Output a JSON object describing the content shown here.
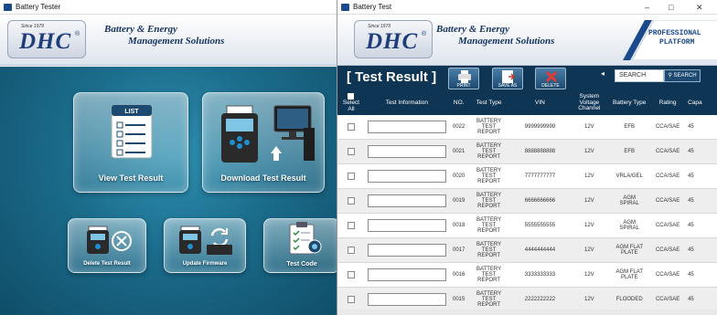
{
  "colors": {
    "header_bg": "#0f3554",
    "brand_blue": "#1f3d7a",
    "panel_teal": "#1b6b8b"
  },
  "left_window": {
    "title": "Battery Tester",
    "logo": {
      "since": "Since 1979",
      "brand": "DHC",
      "reg": "®"
    },
    "tagline_line1": "Battery & Energy",
    "tagline_line2": "Management Solutions",
    "tiles": {
      "view": {
        "label": "View Test Result",
        "icon": "list-icon",
        "list_caption": "LIST"
      },
      "download": {
        "label": "Download Test Result",
        "icon": "tester-to-pc-icon"
      },
      "delete": {
        "label": "Delete Test Result",
        "icon": "tester-delete-icon"
      },
      "update": {
        "label": "Update Firmware",
        "icon": "tester-sync-icon"
      },
      "testcode": {
        "label": "Test Code",
        "icon": "clipboard-badge-icon"
      }
    }
  },
  "right_window": {
    "title": "Battery Test",
    "controls": {
      "minimize": "–",
      "maximize": "□",
      "close": "✕"
    },
    "logo": {
      "since": "Since 1979",
      "brand": "DHC",
      "reg": "®"
    },
    "tagline_line1": "Battery & Energy",
    "tagline_line2": "Management Solutions",
    "platform_line1": "PROFESSIONAL",
    "platform_line2": "PLATFORM",
    "heading": "[ Test Result ]",
    "toolbar": {
      "print": "PRINT",
      "save_as": "SAVE AS",
      "delete": "DELETE"
    },
    "search": {
      "label": "SEARCH",
      "value": "SEARCH",
      "button": "SEARCH"
    },
    "columns": {
      "select": "Select",
      "select_all": "All",
      "test_information": "Test Information",
      "no": "NO.",
      "test_type": "Test Type",
      "vin": "VIN",
      "system_voltage_1": "System",
      "system_voltage_2": "Voltage",
      "system_voltage_3": "Channel",
      "battery_type": "Battery Type",
      "rating": "Rating",
      "capacity": "Capa"
    },
    "rows": [
      {
        "no": "0022",
        "type1": "BATTERY",
        "type2": "TEST",
        "type3": "REPORT",
        "vin": "9999999999",
        "volt": "12V",
        "bt1": "EFB",
        "bt2": "",
        "rating": "CCA/SAE",
        "cap": "45"
      },
      {
        "no": "0021",
        "type1": "BATTERY",
        "type2": "TEST",
        "type3": "REPORT",
        "vin": "8888888888",
        "volt": "12V",
        "bt1": "EFB",
        "bt2": "",
        "rating": "CCA/SAE",
        "cap": "45"
      },
      {
        "no": "0020",
        "type1": "BATTERY",
        "type2": "TEST",
        "type3": "REPORT",
        "vin": "7777777777",
        "volt": "12V",
        "bt1": "VRLA/GEL",
        "bt2": "",
        "rating": "CCA/SAE",
        "cap": "45"
      },
      {
        "no": "0019",
        "type1": "BATTERY",
        "type2": "TEST",
        "type3": "REPORT",
        "vin": "6666666666",
        "volt": "12V",
        "bt1": "AGM",
        "bt2": "SPIRAL",
        "rating": "CCA/SAE",
        "cap": "45"
      },
      {
        "no": "0018",
        "type1": "BATTERY",
        "type2": "TEST",
        "type3": "REPORT",
        "vin": "5555555555",
        "volt": "12V",
        "bt1": "AGM",
        "bt2": "SPIRAL",
        "rating": "CCA/SAE",
        "cap": "45"
      },
      {
        "no": "0017",
        "type1": "BATTERY",
        "type2": "TEST",
        "type3": "REPORT",
        "vin": "4444444444",
        "volt": "12V",
        "bt1": "AGM FLAT",
        "bt2": "PLATE",
        "rating": "CCA/SAE",
        "cap": "45"
      },
      {
        "no": "0016",
        "type1": "BATTERY",
        "type2": "TEST",
        "type3": "REPORT",
        "vin": "3333333333",
        "volt": "12V",
        "bt1": "AGM FLAT",
        "bt2": "PLATE",
        "rating": "CCA/SAE",
        "cap": "45"
      },
      {
        "no": "0015",
        "type1": "BATTERY",
        "type2": "TEST",
        "type3": "REPORT",
        "vin": "2222222222",
        "volt": "12V",
        "bt1": "FLOODED",
        "bt2": "",
        "rating": "CCA/SAE",
        "cap": "45"
      }
    ]
  }
}
